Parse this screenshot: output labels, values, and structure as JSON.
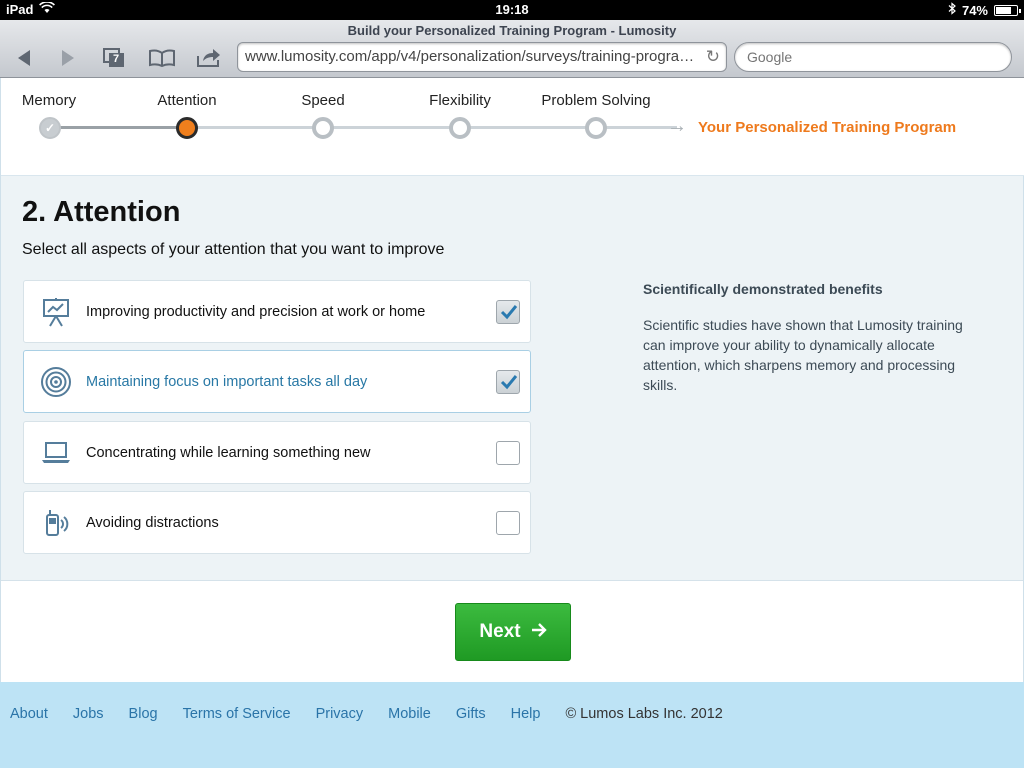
{
  "status_bar": {
    "device": "iPad",
    "time": "19:18",
    "battery": "74%",
    "battery_level": 0.74
  },
  "browser": {
    "title": "Build your Personalized Training Program - Lumosity",
    "tab_count": "7",
    "url": "www.lumosity.com/app/v4/personalization/surveys/training-progra…",
    "search_placeholder": "Google"
  },
  "progress": {
    "steps": [
      {
        "label": "Memory",
        "state": "done"
      },
      {
        "label": "Attention",
        "state": "active"
      },
      {
        "label": "Speed",
        "state": "todo"
      },
      {
        "label": "Flexibility",
        "state": "todo"
      },
      {
        "label": "Problem Solving",
        "state": "todo"
      }
    ],
    "goal": "Your Personalized Training Program",
    "active_color": "#f07f1d"
  },
  "survey": {
    "title": "2. Attention",
    "subtitle": "Select all aspects of your attention that you want to improve",
    "options": [
      {
        "label": "Improving productivity and precision at work or home",
        "icon": "presentation-chart-icon",
        "checked": true
      },
      {
        "label": "Maintaining focus on important tasks all day",
        "icon": "target-icon",
        "checked": true
      },
      {
        "label": "Concentrating while learning something new",
        "icon": "laptop-icon",
        "checked": false
      },
      {
        "label": "Avoiding distractions",
        "icon": "phone-ringing-icon",
        "checked": false
      }
    ]
  },
  "benefits": {
    "title": "Scientifically demonstrated benefits",
    "body": "Scientific studies have shown that Lumosity training can improve your ability to dynamically allocate attention, which sharpens memory and processing skills."
  },
  "actions": {
    "next_label": "Next",
    "next_color": "#2aa92e"
  },
  "footer": {
    "links": [
      "About",
      "Jobs",
      "Blog",
      "Terms of Service",
      "Privacy",
      "Mobile",
      "Gifts",
      "Help"
    ],
    "copyright": "© Lumos Labs Inc. 2012"
  }
}
